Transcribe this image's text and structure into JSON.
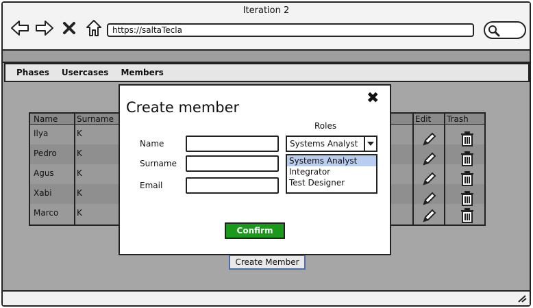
{
  "window": {
    "title": "Iteration 2"
  },
  "browser": {
    "url": "https://saltaTecla",
    "icons": [
      "back-arrow-icon",
      "forward-arrow-icon",
      "close-x-icon",
      "home-icon",
      "search-icon"
    ]
  },
  "menu": {
    "items": [
      "Phases",
      "Usercases",
      "Members"
    ]
  },
  "table": {
    "headers": {
      "name": "Name",
      "surname": "Surname",
      "edit": "Edit",
      "trash": "Trash"
    },
    "rows": [
      {
        "name": "Ilya",
        "surname": "K"
      },
      {
        "name": "Pedro",
        "surname": "K"
      },
      {
        "name": "Agus",
        "surname": "K"
      },
      {
        "name": "Xabi",
        "surname": "K"
      },
      {
        "name": "Marco",
        "surname": "K"
      }
    ]
  },
  "page": {
    "create_member_button": "Create Member"
  },
  "modal": {
    "title": "Create member",
    "close_glyph": "✖",
    "fields": {
      "name_label": "Name",
      "surname_label": "Surname",
      "email_label": "Email"
    },
    "roles": {
      "label": "Roles",
      "selected": "Systems Analyst",
      "options": [
        "Systems Analyst",
        "Integrator",
        "Test Designer"
      ]
    },
    "confirm_label": "Confirm"
  },
  "colors": {
    "confirm": "#1a9a1a",
    "selected_option": "#b9cdf0",
    "button_border": "#4a6ea8"
  }
}
